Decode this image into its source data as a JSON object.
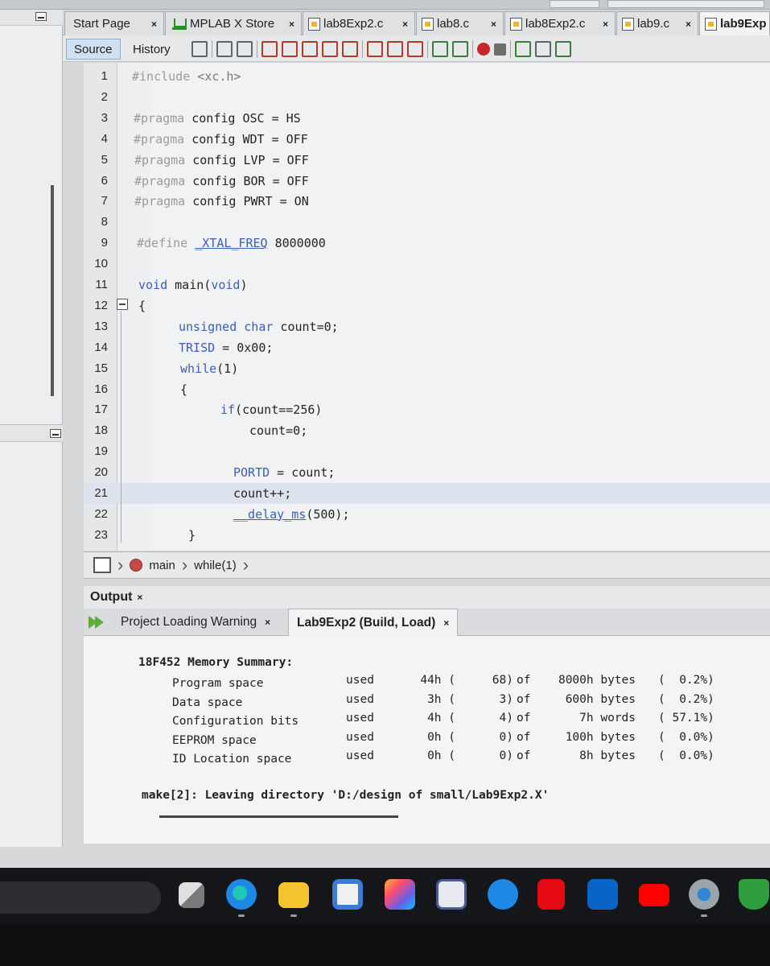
{
  "tabs": [
    {
      "label": "Start Page",
      "close": "×",
      "icon": "none"
    },
    {
      "label": "MPLAB X Store",
      "close": "×",
      "icon": "store-icon"
    },
    {
      "label": "lab8Exp2.c",
      "close": "×",
      "icon": "file-icon"
    },
    {
      "label": "lab8.c",
      "close": "×",
      "icon": "file-icon"
    },
    {
      "label": "lab8Exp2.c",
      "close": "×",
      "icon": "file-icon"
    },
    {
      "label": "lab9.c",
      "close": "×",
      "icon": "file-icon"
    },
    {
      "label": "lab9Exp",
      "close": "",
      "icon": "file-icon"
    }
  ],
  "toolbar": {
    "source": "Source",
    "history": "History"
  },
  "code": [
    {
      "n": "1",
      "text": "#include <xc.h>"
    },
    {
      "n": "2",
      "text": ""
    },
    {
      "n": "3",
      "text": "#pragma config OSC = HS"
    },
    {
      "n": "4",
      "text": "#pragma config WDT = OFF"
    },
    {
      "n": "5",
      "text": "#pragma config LVP = OFF"
    },
    {
      "n": "6",
      "text": "#pragma config BOR = OFF"
    },
    {
      "n": "7",
      "text": "#pragma config PWRT = ON"
    },
    {
      "n": "8",
      "text": ""
    },
    {
      "n": "9",
      "text": "#define _XTAL_FREQ 8000000"
    },
    {
      "n": "10",
      "text": ""
    },
    {
      "n": "11",
      "text": "void main(void)"
    },
    {
      "n": "12",
      "text": "{"
    },
    {
      "n": "13",
      "text": "unsigned char count=0;"
    },
    {
      "n": "14",
      "text": "TRISD = 0x00;"
    },
    {
      "n": "15",
      "text": "while(1)"
    },
    {
      "n": "16",
      "text": "{"
    },
    {
      "n": "17",
      "text": "if(count==256)"
    },
    {
      "n": "18",
      "text": "count=0;"
    },
    {
      "n": "19",
      "text": ""
    },
    {
      "n": "20",
      "text": "PORTD = count;"
    },
    {
      "n": "21",
      "text": "count++;"
    },
    {
      "n": "22",
      "text": "__delay_ms(500);"
    },
    {
      "n": "23",
      "text": "}"
    }
  ],
  "breadcrumb": {
    "func": "main",
    "loop": "while(1)"
  },
  "output": {
    "title": "Output",
    "close": "×",
    "tabs": [
      {
        "label": "Project Loading Warning",
        "close": "×"
      },
      {
        "label": "Lab9Exp2 (Build, Load)",
        "close": "×"
      }
    ],
    "summary_title": "18F452 Memory Summary:",
    "rows": [
      {
        "name": "Program space",
        "used": "used",
        "hex": "44h (",
        "dec": "68)",
        "of": "of",
        "total": "8000h bytes",
        "pct": "(  0.2%)"
      },
      {
        "name": "Data space",
        "used": "used",
        "hex": "3h (",
        "dec": "3)",
        "of": "of",
        "total": "600h bytes",
        "pct": "(  0.2%)"
      },
      {
        "name": "Configuration bits",
        "used": "used",
        "hex": "4h (",
        "dec": "4)",
        "of": "of",
        "total": "7h words",
        "pct": "( 57.1%)"
      },
      {
        "name": "EEPROM space",
        "used": "used",
        "hex": "0h (",
        "dec": "0)",
        "of": "of",
        "total": "100h bytes",
        "pct": "(  0.0%)"
      },
      {
        "name": "ID Location space",
        "used": "used",
        "hex": "0h (",
        "dec": "0)",
        "of": "of",
        "total": "8h bytes",
        "pct": "(  0.0%)"
      }
    ],
    "make_line": "make[2]: Leaving directory 'D:/design of small/Lab9Exp2.X'"
  },
  "taskbar": {
    "apps": [
      "task-view",
      "edge",
      "file-explorer",
      "microsoft-store",
      "copilot",
      "app-mi",
      "app-chat",
      "netflix",
      "outlook",
      "youtube",
      "settings",
      "security-shield"
    ],
    "colors": {
      "edge": "#1e88e5",
      "explorer": "#f4c430",
      "netflix": "#e50914",
      "outlook": "#0a64c8",
      "youtube": "#ff0000"
    }
  },
  "colors": {
    "keyword": "#3a5fb5",
    "directive": "#9a9a9a",
    "number": "#222222",
    "highlight": "#dde3ec"
  }
}
